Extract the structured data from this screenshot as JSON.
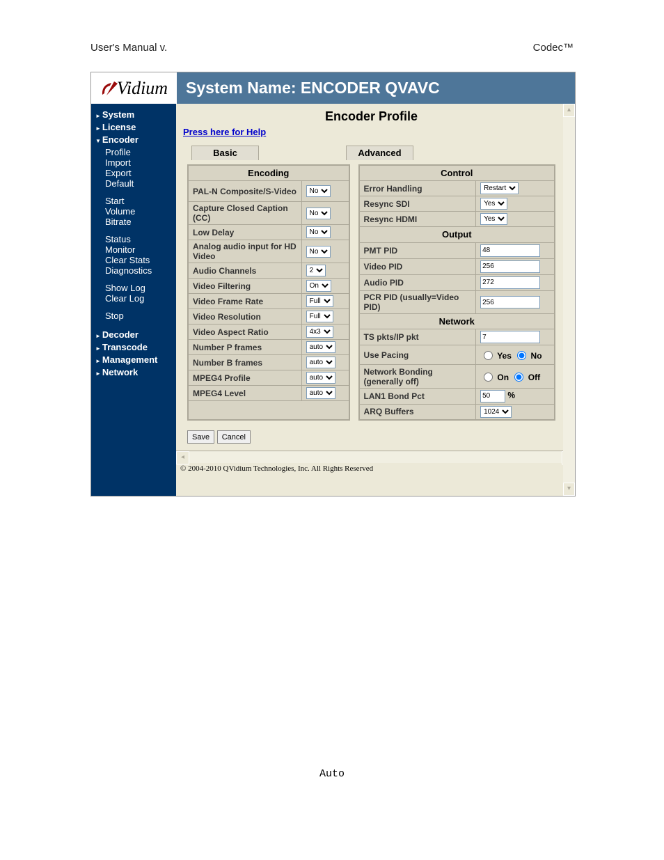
{
  "doc": {
    "header_left": "User's Manual v.",
    "header_right": "Codec™",
    "footnote": "Auto"
  },
  "app": {
    "logo": "Vidium",
    "title": "System Name: ENCODER QVAVC",
    "page_title": "Encoder Profile",
    "help_link": "Press here for Help",
    "tabs": {
      "basic": "Basic",
      "advanced": "Advanced"
    },
    "sidebar": {
      "items": [
        {
          "label": "System",
          "kind": "tri"
        },
        {
          "label": "License",
          "kind": "tri"
        },
        {
          "label": "Encoder",
          "kind": "tridown"
        },
        {
          "label": "Profile",
          "kind": "sub"
        },
        {
          "label": "Import",
          "kind": "sub"
        },
        {
          "label": "Export",
          "kind": "sub"
        },
        {
          "label": "Default",
          "kind": "sub"
        },
        {
          "label": "Start",
          "kind": "sub group"
        },
        {
          "label": "Volume",
          "kind": "sub"
        },
        {
          "label": "Bitrate",
          "kind": "sub"
        },
        {
          "label": "Status",
          "kind": "sub group"
        },
        {
          "label": "Monitor",
          "kind": "sub"
        },
        {
          "label": "Clear Stats",
          "kind": "sub"
        },
        {
          "label": "Diagnostics",
          "kind": "sub"
        },
        {
          "label": "Show Log",
          "kind": "sub group"
        },
        {
          "label": "Clear Log",
          "kind": "sub"
        },
        {
          "label": "Stop",
          "kind": "sub group"
        },
        {
          "label": "Decoder",
          "kind": "tri group2"
        },
        {
          "label": "Transcode",
          "kind": "tri"
        },
        {
          "label": "Management",
          "kind": "tri"
        },
        {
          "label": "Network",
          "kind": "tri"
        }
      ]
    },
    "encoding": {
      "header": "Encoding",
      "rows": [
        {
          "label": "PAL-N Composite/S-Video",
          "value": "No",
          "tall": true
        },
        {
          "label": "Capture Closed Caption (CC)",
          "value": "No",
          "tall": true
        },
        {
          "label": "Low Delay",
          "value": "No"
        },
        {
          "label": "Analog audio input for HD Video",
          "value": "No",
          "tall": true
        },
        {
          "label": "Audio Channels",
          "value": "2"
        },
        {
          "label": "Video Filtering",
          "value": "On"
        },
        {
          "label": "Video Frame Rate",
          "value": "Full"
        },
        {
          "label": "Video Resolution",
          "value": "Full"
        },
        {
          "label": "Video Aspect Ratio",
          "value": "4x3"
        },
        {
          "label": "Number P frames",
          "value": "auto"
        },
        {
          "label": "Number B frames",
          "value": "auto"
        },
        {
          "label": "MPEG4 Profile",
          "value": "auto"
        },
        {
          "label": "MPEG4 Level",
          "value": "auto"
        }
      ]
    },
    "control": {
      "header": "Control",
      "rows": [
        {
          "label": "Error Handling",
          "value": "Restart",
          "type": "select"
        },
        {
          "label": "Resync SDI",
          "value": "Yes",
          "type": "select"
        },
        {
          "label": "Resync HDMI",
          "value": "Yes",
          "type": "select"
        }
      ]
    },
    "output": {
      "header": "Output",
      "rows": [
        {
          "label": "PMT PID",
          "value": "48",
          "type": "text"
        },
        {
          "label": "Video PID",
          "value": "256",
          "type": "text"
        },
        {
          "label": "Audio PID",
          "value": "272",
          "type": "text"
        },
        {
          "label": "PCR PID (usually=Video PID)",
          "value": "256",
          "type": "text",
          "tall": true
        }
      ]
    },
    "network": {
      "header": "Network",
      "ts_pkts": {
        "label": "TS pkts/IP pkt",
        "value": "7"
      },
      "use_pacing": {
        "label": "Use Pacing",
        "on": "Yes",
        "off": "No",
        "value": "off"
      },
      "bonding": {
        "label": "Network Bonding (generally off)",
        "on": "On",
        "off": "Off",
        "value": "off"
      },
      "lan1": {
        "label": "LAN1 Bond Pct",
        "value": "50",
        "unit": "%"
      },
      "arq": {
        "label": "ARQ Buffers",
        "value": "1024"
      }
    },
    "buttons": {
      "save": "Save",
      "cancel": "Cancel"
    },
    "copyright": "© 2004-2010 QVidium Technologies, Inc.   All Rights Reserved"
  }
}
